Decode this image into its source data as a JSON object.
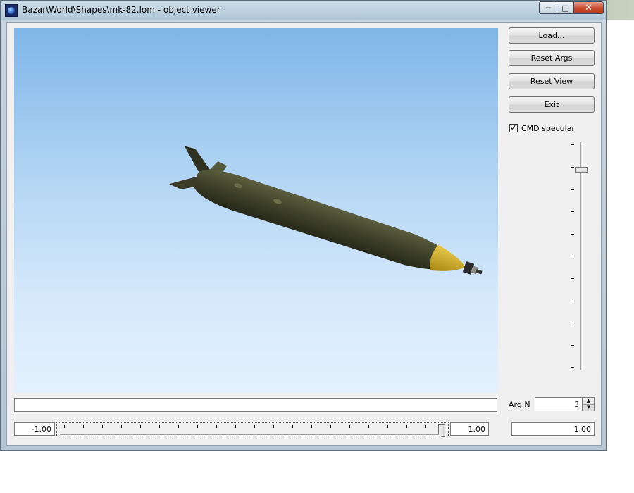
{
  "window": {
    "title": "Bazar\\World\\Shapes\\mk-82.lom - object viewer",
    "app_icon": "globe-app-icon",
    "caption_buttons": {
      "minimize": "─",
      "maximize": "□",
      "close": "✕"
    }
  },
  "viewport": {
    "object": "mk-82 bomb",
    "sky_colors": [
      "#7fb6e8",
      "#e4f1fd"
    ],
    "bomb_body_color": "#41442a",
    "fuze_color": "#d4b21f"
  },
  "buttons": {
    "load": "Load...",
    "reset_args": "Reset Args",
    "reset_view": "Reset View",
    "exit": "Exit"
  },
  "specular": {
    "label": "CMD specular",
    "checked": true,
    "check_glyph": "✓"
  },
  "status": {
    "text": ""
  },
  "arg_n": {
    "label": "Arg N",
    "value": "3",
    "up": "▲",
    "down": "▼"
  },
  "range": {
    "min": "-1.00",
    "max": "1.00",
    "current": "1.00",
    "slider_position": 1.0
  }
}
